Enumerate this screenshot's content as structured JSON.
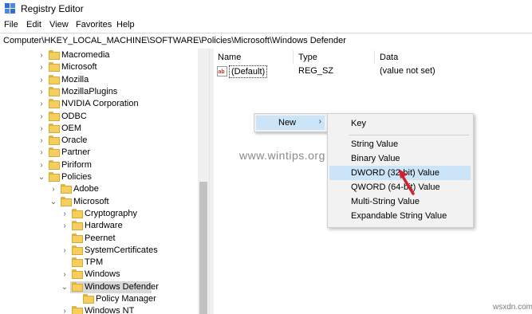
{
  "window": {
    "title": "Registry Editor",
    "app_icon": "registry-editor-icon"
  },
  "menu": [
    {
      "label": "File"
    },
    {
      "label": "Edit"
    },
    {
      "label": "View"
    },
    {
      "label": "Favorites"
    },
    {
      "label": "Help"
    }
  ],
  "address": "Computer\\HKEY_LOCAL_MACHINE\\SOFTWARE\\Policies\\Microsoft\\Windows Defender",
  "tree": [
    {
      "label": "Macromedia",
      "level": 0,
      "chev": "›"
    },
    {
      "label": "Microsoft",
      "level": 0,
      "chev": "›"
    },
    {
      "label": "Mozilla",
      "level": 0,
      "chev": "›"
    },
    {
      "label": "MozillaPlugins",
      "level": 0,
      "chev": "›"
    },
    {
      "label": "NVIDIA Corporation",
      "level": 0,
      "chev": "›"
    },
    {
      "label": "ODBC",
      "level": 0,
      "chev": "›"
    },
    {
      "label": "OEM",
      "level": 0,
      "chev": "›"
    },
    {
      "label": "Oracle",
      "level": 0,
      "chev": "›"
    },
    {
      "label": "Partner",
      "level": 0,
      "chev": "›"
    },
    {
      "label": "Piriform",
      "level": 0,
      "chev": "›"
    },
    {
      "label": "Policies",
      "level": 0,
      "chev": "⌄"
    },
    {
      "label": "Adobe",
      "level": 1,
      "chev": "›"
    },
    {
      "label": "Microsoft",
      "level": 1,
      "chev": "⌄"
    },
    {
      "label": "Cryptography",
      "level": 2,
      "chev": "›"
    },
    {
      "label": "Hardware",
      "level": 2,
      "chev": "›"
    },
    {
      "label": "Peernet",
      "level": 2,
      "chev": ""
    },
    {
      "label": "SystemCertificates",
      "level": 2,
      "chev": "›"
    },
    {
      "label": "TPM",
      "level": 2,
      "chev": ""
    },
    {
      "label": "Windows",
      "level": 2,
      "chev": "›"
    },
    {
      "label": "Windows Defender",
      "level": 2,
      "chev": "⌄",
      "selected": true
    },
    {
      "label": "Policy Manager",
      "level": 3,
      "chev": ""
    },
    {
      "label": "Windows NT",
      "level": 2,
      "chev": "›"
    }
  ],
  "columns": {
    "name": "Name",
    "type": "Type",
    "data": "Data"
  },
  "values": [
    {
      "name": "(Default)",
      "type": "REG_SZ",
      "data": "(value not set)",
      "icon": "string-value-icon"
    }
  ],
  "context_menu": {
    "new_label": "New",
    "arrow": "›"
  },
  "submenu": {
    "key": "Key",
    "items": [
      {
        "label": "String Value"
      },
      {
        "label": "Binary Value"
      },
      {
        "label": "DWORD (32-bit) Value",
        "highlighted": true
      },
      {
        "label": "QWORD (64-bit) Value"
      },
      {
        "label": "Multi-String Value"
      },
      {
        "label": "Expandable String Value"
      }
    ]
  },
  "watermark": "www.wintips.org",
  "watermark_corner": "wsxdn.com",
  "colors": {
    "highlight": "#cce4f7",
    "selection": "#d9d9d9",
    "folder": "#f5cf5d",
    "arrow": "#d4202a"
  }
}
